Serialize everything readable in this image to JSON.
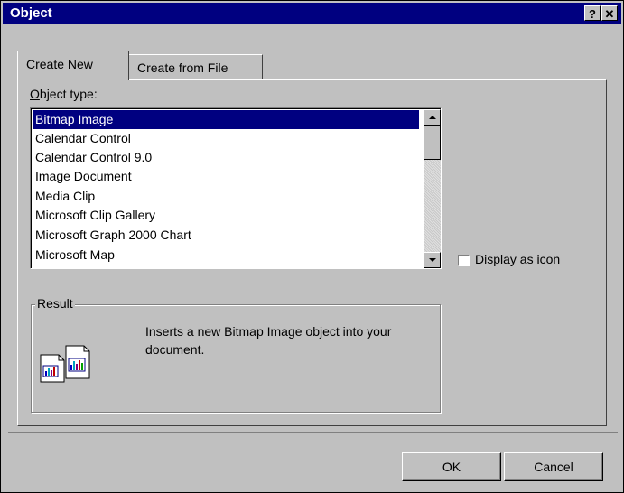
{
  "window": {
    "title": "Object",
    "help_button": "?",
    "close_button": "✕"
  },
  "tabs": [
    {
      "label": "Create New",
      "active": true
    },
    {
      "label": "Create from File",
      "active": false
    }
  ],
  "object_type": {
    "label_prefix": "O",
    "label_underlined": "b",
    "label_suffix": "ject type:",
    "items": [
      {
        "label": "Bitmap Image",
        "selected": true
      },
      {
        "label": "Calendar Control",
        "selected": false
      },
      {
        "label": "Calendar Control 9.0",
        "selected": false
      },
      {
        "label": "Image Document",
        "selected": false
      },
      {
        "label": "Media Clip",
        "selected": false
      },
      {
        "label": "Microsoft Clip Gallery",
        "selected": false
      },
      {
        "label": "Microsoft Graph 2000 Chart",
        "selected": false
      },
      {
        "label": "Microsoft Map",
        "selected": false
      }
    ]
  },
  "display_as_icon": {
    "label_prefix": "Displ",
    "label_underlined": "a",
    "label_suffix": "y as icon",
    "checked": false
  },
  "result": {
    "title": "Result",
    "text": "Inserts a new Bitmap Image object into your document."
  },
  "buttons": {
    "ok": "OK",
    "cancel": "Cancel"
  },
  "colors": {
    "title_bar": "#000080",
    "selection": "#000080",
    "face": "#c0c0c0"
  }
}
